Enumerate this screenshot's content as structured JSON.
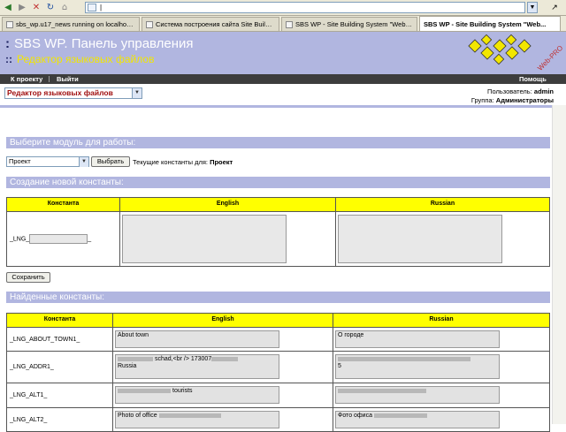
{
  "browser": {
    "address_value": "|",
    "tabs": [
      {
        "label": "sbs_wp.u17_news running on localhost - p..."
      },
      {
        "label": "Система построения сайта Site Building ..."
      },
      {
        "label": "SBS WP - Site Building System \"Web-Pro\""
      },
      {
        "label": "SBS WP - Site Building System \"Web..."
      }
    ]
  },
  "header": {
    "title": "SBS WP. Панель управления",
    "subtitle": "Редактор языковых файлов",
    "logo_text": "Web-PRO",
    "title_color": "#ffffff",
    "subtitle_color": "#f2e600",
    "bg_color": "#b1b6e0"
  },
  "nav": {
    "project": "К проекту",
    "logout": "Выйти",
    "help": "Помощь"
  },
  "sub": {
    "section_select": "Редактор языковых файлов",
    "user_label": "Пользователь:",
    "user_value": "admin",
    "group_label": "Группа:",
    "group_value": "Администраторы"
  },
  "module": {
    "heading": "Выберите модуль для работы:",
    "selected": "Проект",
    "choose_button": "Выбрать",
    "current_label": "Текущие константы для:",
    "current_value": "Проект"
  },
  "create": {
    "heading": "Создание новой константы:",
    "col_const": "Константа",
    "col_en": "English",
    "col_ru": "Russian",
    "prefix": "_LNG_",
    "suffix": "_",
    "save_button": "Сохранить"
  },
  "found": {
    "heading": "Найденные константы:",
    "col_const": "Константа",
    "col_en": "English",
    "col_ru": "Russian",
    "rows": [
      {
        "name": "_LNG_ABOUT_TOWN1_",
        "en": "About town",
        "ru": "О городе"
      },
      {
        "name": "_LNG_ADDR1_",
        "en": "schad,<br /> 173007",
        "en2": "Russia",
        "ru": "",
        "ru2": "5"
      },
      {
        "name": "_LNG_ALT1_",
        "en": "tourists",
        "ru": ""
      },
      {
        "name": "_LNG_ALT2_",
        "en": "Photo of office",
        "ru": "Фото офиса"
      }
    ]
  }
}
